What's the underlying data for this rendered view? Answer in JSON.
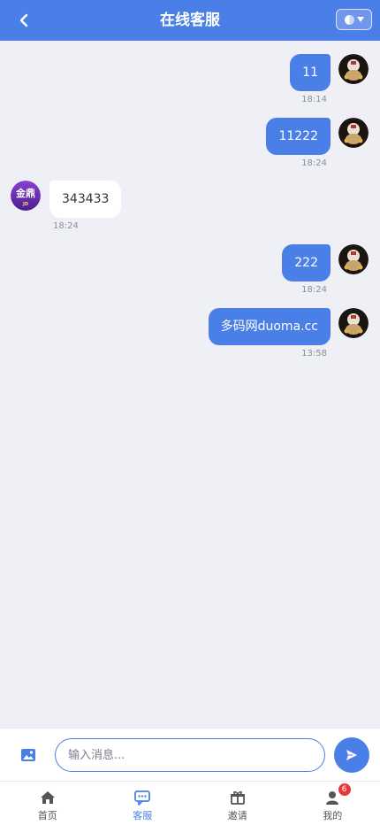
{
  "header": {
    "title": "在线客服",
    "back_icon": "chevron-left-icon",
    "theme_icon": "half-moon-icon"
  },
  "messages": [
    {
      "id": "m1",
      "direction": "out",
      "text": "11",
      "time": "18:14"
    },
    {
      "id": "m2",
      "direction": "out",
      "text": "11222",
      "time": "18:24"
    },
    {
      "id": "m3",
      "direction": "in",
      "text": "343433",
      "time": "18:24"
    },
    {
      "id": "m4",
      "direction": "out",
      "text": "222",
      "time": "18:24"
    },
    {
      "id": "m5",
      "direction": "out",
      "text": "多码网duoma.cc",
      "time": "13:58"
    }
  ],
  "agent_avatar_text": "金鼎",
  "agent_avatar_subtext": "JD",
  "composer": {
    "image_icon": "image-icon",
    "placeholder": "输入消息...",
    "value": "",
    "send_icon": "send-icon"
  },
  "tabs": [
    {
      "label": "首页",
      "icon": "home-icon",
      "active": false
    },
    {
      "label": "客服",
      "icon": "chat-icon",
      "active": true
    },
    {
      "label": "邀请",
      "icon": "gift-icon",
      "active": false
    },
    {
      "label": "我的",
      "icon": "user-icon",
      "active": false,
      "badge": "6"
    }
  ],
  "colors": {
    "accent": "#4b7fe8",
    "background": "#eef0f5",
    "badge": "#e53935"
  }
}
